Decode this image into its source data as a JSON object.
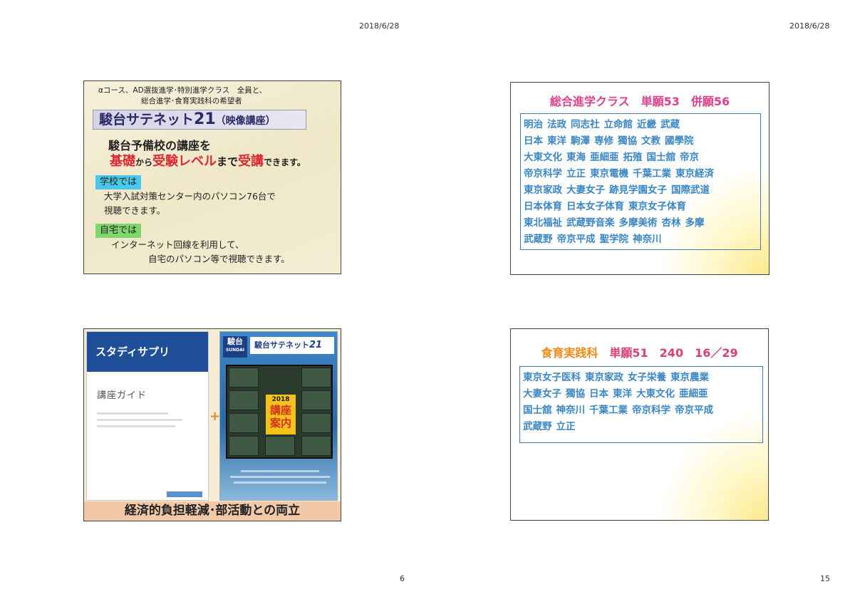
{
  "header": {
    "date_left": "2018/6/28",
    "date_right": "2018/6/28"
  },
  "footer": {
    "page_left": "6",
    "page_right": "15"
  },
  "slide_sundai": {
    "intro_line1": "αコース、AD選抜進学･特別進学クラス　全員と、",
    "intro_line2": "総合進学･食育実践科の希望者",
    "banner_main": "駿台サテネット",
    "banner_num": "21",
    "banner_sub": "（映像講座）",
    "heading1": "駿台予備校の講座を",
    "heading2_a": "基礎",
    "heading2_b": "から",
    "heading2_c": "受験レベル",
    "heading2_d": "まで",
    "heading2_e": "受講",
    "heading2_f": "できます。",
    "school_tag": "学校では",
    "school_text1": "大学入試対策センター内のパソコン76台で",
    "school_text2": "視聴できます。",
    "home_tag": "自宅では",
    "home_text1": "インターネット回線を利用して、",
    "home_text2": "自宅のパソコン等で視聴できます。"
  },
  "slide_sogo": {
    "title_a": "総合進学クラス　単願53　併願56",
    "rows": [
      [
        "明治",
        "法政",
        "同志社",
        "立命館",
        "近畿",
        "武蔵"
      ],
      [
        "日本",
        "東洋",
        "駒澤",
        "専修",
        "獨協",
        "文教",
        "國學院"
      ],
      [
        "大東文化",
        "東海",
        "亜細亜",
        "拓殖",
        "国士舘",
        "帝京"
      ],
      [
        "帝京科学",
        "立正",
        "東京電機",
        "千葉工業",
        "東京経済"
      ],
      [
        "東京家政",
        "大妻女子",
        "跡見学園女子",
        "国際武道"
      ],
      [
        "日本体育",
        "日本女子体育",
        "東京女子体育"
      ],
      [
        "東北福祉",
        "武蔵野音楽",
        "多摩美術",
        "杏林",
        "多摩"
      ],
      [
        "武蔵野",
        "帝京平成",
        "聖学院",
        "神奈川"
      ]
    ]
  },
  "slide_shokuiku": {
    "title_a": "食育実践科",
    "title_b": "単願51　240　16／29",
    "rows": [
      [
        "東京女子医科",
        "東京家政",
        "女子栄養",
        "東京農業"
      ],
      [
        "大妻女子",
        "獨協",
        "日本",
        "東洋",
        "大東文化",
        "亜細亜"
      ],
      [
        "国士舘",
        "神奈川",
        "千葉工業",
        "帝京科学",
        "帝京平成"
      ],
      [
        "武蔵野",
        "立正"
      ]
    ]
  },
  "slide_sapuri": {
    "brand": "スタディサプリ",
    "guide_title": "講座ガイド",
    "plus": "+",
    "pamph_logo": "駿台",
    "pamph_logo_en": "SUNDAI",
    "pamph_title": "駿台サテネット",
    "pamph_title_num": "21",
    "pamph_year": "2018",
    "pamph_center1": "講座",
    "pamph_center2": "案内",
    "footer": "経済的負担軽減･部活動との両立"
  }
}
